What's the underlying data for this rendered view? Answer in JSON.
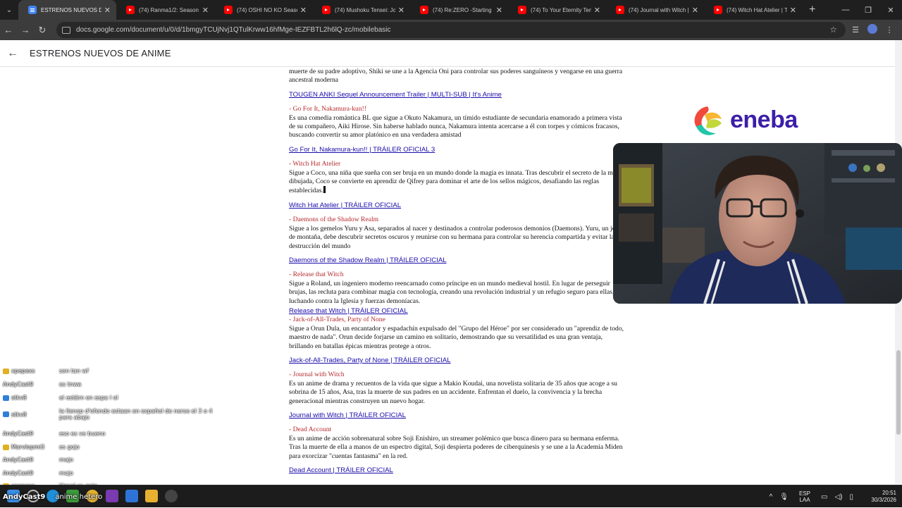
{
  "browser": {
    "tabs": [
      {
        "title": "ESTRENOS NUEVOS DE A",
        "type": "doc",
        "active": true
      },
      {
        "title": "(74) Ranma1/2: Season 3",
        "type": "youtube"
      },
      {
        "title": "(74) OSHI NO KO Season",
        "type": "youtube"
      },
      {
        "title": "(74) Mushoku Tensei: Job",
        "type": "youtube"
      },
      {
        "title": "(74) Re:ZERO -Starting Lif",
        "type": "youtube"
      },
      {
        "title": "(74) To Your Eternity Tem",
        "type": "youtube"
      },
      {
        "title": "(74) Journal with Witch | T",
        "type": "youtube"
      },
      {
        "title": "(74) Witch Hat Atelier | Th",
        "type": "youtube"
      }
    ],
    "url": "docs.google.com/document/u/0/d/1bmgyTCUjNvj1QTulKrww16hfMge-IEZFBTL2h6lQ-zc/mobilebasic"
  },
  "doc": {
    "title": "ESTRENOS NUEVOS DE ANIME",
    "first_text": "muerte de su padre adoptivo, Shiki se une a la Agencia Oni para controlar sus poderes sanguíneos y vengarse en una guerra ancestral moderna",
    "first_link": "TOUGEN ANKI Sequel Announcement Trailer | MULTI-SUB | It's Anime",
    "entries": [
      {
        "heading": "- Go For It, Nakamura-kun!!",
        "description": "Es una comedia romántica BL que sigue a Okuto Nakamura, un tímido estudiante de secundaria enamorado a primera vista de su compañero, Aiki Hirose. Sin haberse hablado nunca, Nakamura intenta acercarse a él con torpes y cómicos fracasos, buscando convertir su amor platónico en una verdadera amistad",
        "link": "Go For It, Nakamura-kun!! | TRÁILER OFICIAL 3"
      },
      {
        "heading": "- Witch Hat Atelier",
        "description": "Sigue a Coco, una niña que sueña con ser bruja en un mundo donde la magia es innata. Tras descubrir el secreto de la magia dibujada, Coco se convierte en aprendiz de Qifrey para dominar el arte de los sellos mágicos, desafiando las reglas establecidas.",
        "link": "Witch Hat Atelier | TRÁILER OFICIAL"
      },
      {
        "heading": "- Daemons of the Shadow Realm",
        "description": "Sigue a los gemelos Yuru y Asa, separados al nacer y destinados a controlar poderosos demonios (Daemons). Yuru, un joven de montaña, debe descubrir secretos oscuros y reunirse con su hermana para controlar su herencia compartida y evitar la destrucción del mundo",
        "link": "Daemons of the Shadow Realm | TRÁILER OFICIAL"
      },
      {
        "heading": "- Release that Witch",
        "description": "Sigue a Roland, un ingeniero moderno reencarnado como príncipe en un mundo medieval hostil. En lugar de perseguir brujas, las recluta para combinar magia con tecnología, creando una revolución industrial y un refugio seguro para ellas, luchando contra la Iglesia y fuerzas demoníacas.",
        "link": "Release that Witch | TRÁILER OFICIAL"
      },
      {
        "heading": "- Jack-of-All-Trades, Party of None",
        "description": "Sigue a Orun Dula, un encantador y espadachín expulsado del \"Grupo del Héroe\" por ser considerado un \"aprendiz de todo, maestro de nada\". Orun decide forjarse un camino en solitario, demostrando que su versatilidad es una gran ventaja, brillando en batallas épicas mientras protege a otros.",
        "link": "Jack-of-All-Trades, Party of None | TRÁILER OFICIAL"
      },
      {
        "heading": "- Journal with Witch",
        "description": "Es un anime de drama y recuentos de la vida que sigue a Makio Koudai, una novelista solitaria de 35 años que acoge a su sobrina de 15 años, Asa, tras la muerte de sus padres en un accidente. Enfrentan el duelo, la convivencia y la brecha generacional mientras construyen un nuevo hogar.",
        "link": "Journal with Witch | TRÁILER OFICIAL"
      },
      {
        "heading": "- Dead Account",
        "description": "Es un anime de acción sobrenatural sobre Soji Enishiro, un streamer polémico que busca dinero para su hermana enferma. Tras la muerte de ella a manos de un espectro digital, Soji despierta poderes de ciberquinesis y se une a la Academia Miden para exorcizar \"cuentas fantasma\" en la red.",
        "link": "Dead Account | TRÁILER OFICIAL"
      }
    ]
  },
  "sponsor": {
    "name": "eneba"
  },
  "chat": [
    {
      "user": "xpepexs",
      "message": "son tan wf",
      "badge": "#e0b020"
    },
    {
      "user": "AndyCast9",
      "message": "es tnwa",
      "badge": ""
    },
    {
      "user": "stkv8",
      "message": "el estárn en espa l ol",
      "badge": "#2f7fd8"
    },
    {
      "user": "stkv8",
      "message": "la llenop d'ofendo estaan en español de nerse el 3 o 4 para abajo",
      "badge": "#2f7fd8"
    },
    {
      "user": "AndyCast9",
      "message": "eso es ve bueno",
      "badge": ""
    },
    {
      "user": "Marvlopmi3",
      "message": "es gojo",
      "badge": "#e0b020"
    },
    {
      "user": "AndyCast9",
      "message": "majo",
      "badge": ""
    },
    {
      "user": "AndyCast9",
      "message": "majo",
      "badge": ""
    },
    {
      "user": "xpepexs",
      "message": "literal es gojo",
      "badge": "#e0b020"
    }
  ],
  "overlay": {
    "left": "AndyCast9",
    "right": "anime hetero"
  },
  "taskbar": {
    "lang_top": "ESP",
    "lang_bottom": "LAA",
    "time": "20:51",
    "date": "30/3/2026"
  },
  "colors": {
    "heading": "#b5292c",
    "link": "#1a0dab",
    "eneba": "#3c1fa8"
  }
}
